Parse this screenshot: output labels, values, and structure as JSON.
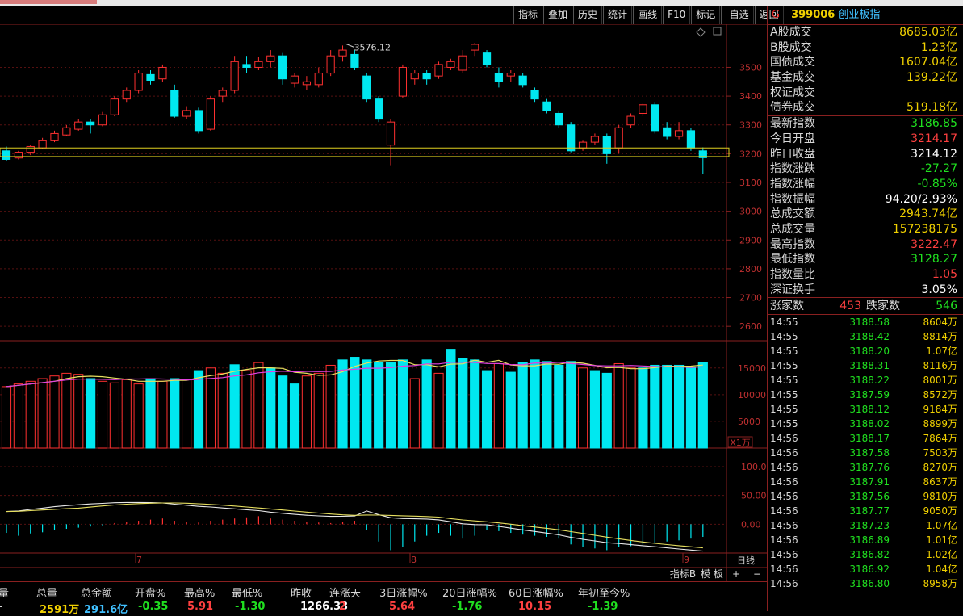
{
  "toolbar": [
    "指标",
    "叠加",
    "历史",
    "统计",
    "画线",
    "F10",
    "标记",
    "-自选",
    "返回"
  ],
  "quote": {
    "flag": "G",
    "code": "399006",
    "name": "创业板指",
    "rows1": [
      {
        "label": "A股成交",
        "value": "8685.03亿",
        "color": "#f0d000"
      },
      {
        "label": "B股成交",
        "value": "1.23亿",
        "color": "#f0d000"
      },
      {
        "label": "国债成交",
        "value": "1607.04亿",
        "color": "#f0d000"
      },
      {
        "label": "基金成交",
        "value": "139.22亿",
        "color": "#f0d000"
      },
      {
        "label": "权证成交",
        "value": "",
        "color": "#f0d000"
      },
      {
        "label": "债券成交",
        "value": "519.18亿",
        "color": "#f0d000"
      }
    ],
    "rows2": [
      {
        "label": "最新指数",
        "value": "3186.85",
        "color": "#20e020"
      },
      {
        "label": "今日开盘",
        "value": "3214.17",
        "color": "#ff4040"
      },
      {
        "label": "昨日收盘",
        "value": "3214.12",
        "color": "#ffffff"
      },
      {
        "label": "指数涨跌",
        "value": "-27.27",
        "color": "#20e020"
      },
      {
        "label": "指数涨幅",
        "value": "-0.85%",
        "color": "#20e020"
      },
      {
        "label": "指数振幅",
        "value": "94.20/2.93%",
        "color": "#ffffff"
      },
      {
        "label": "总成交额",
        "value": "2943.74亿",
        "color": "#f0d000"
      },
      {
        "label": "总成交量",
        "value": "157238175",
        "color": "#f0d000"
      },
      {
        "label": "最高指数",
        "value": "3222.47",
        "color": "#ff4040"
      },
      {
        "label": "最低指数",
        "value": "3128.27",
        "color": "#20e020"
      },
      {
        "label": "指数量比",
        "value": "1.05",
        "color": "#ff4040"
      },
      {
        "label": "深证换手",
        "value": "3.05%",
        "color": "#ffffff"
      }
    ],
    "up_label": "涨家数",
    "up_value": "453",
    "down_label": "跌家数",
    "down_value": "546"
  },
  "ticks": [
    {
      "t": "14:55",
      "p": "3188.58",
      "v": "8604万"
    },
    {
      "t": "14:55",
      "p": "3188.42",
      "v": "8814万"
    },
    {
      "t": "14:55",
      "p": "3188.20",
      "v": "1.07亿"
    },
    {
      "t": "14:55",
      "p": "3188.31",
      "v": "8116万"
    },
    {
      "t": "14:55",
      "p": "3188.22",
      "v": "8001万"
    },
    {
      "t": "14:55",
      "p": "3187.59",
      "v": "8572万"
    },
    {
      "t": "14:55",
      "p": "3188.12",
      "v": "9184万"
    },
    {
      "t": "14:55",
      "p": "3188.02",
      "v": "8899万"
    },
    {
      "t": "14:56",
      "p": "3188.17",
      "v": "7864万"
    },
    {
      "t": "14:56",
      "p": "3187.58",
      "v": "7503万"
    },
    {
      "t": "14:56",
      "p": "3187.76",
      "v": "8270万"
    },
    {
      "t": "14:56",
      "p": "3187.91",
      "v": "8637万"
    },
    {
      "t": "14:56",
      "p": "3187.56",
      "v": "9810万"
    },
    {
      "t": "14:56",
      "p": "3187.77",
      "v": "9050万"
    },
    {
      "t": "14:56",
      "p": "3187.23",
      "v": "1.07亿"
    },
    {
      "t": "14:56",
      "p": "3186.89",
      "v": "1.01亿"
    },
    {
      "t": "14:56",
      "p": "3186.82",
      "v": "1.02亿"
    },
    {
      "t": "14:56",
      "p": "3186.92",
      "v": "1.04亿"
    },
    {
      "t": "14:56",
      "p": "3186.80",
      "v": "8958万"
    }
  ],
  "axis": {
    "price": [
      "3500",
      "3400",
      "3300",
      "3200",
      "3100",
      "3000",
      "2900",
      "2800",
      "2700",
      "2600"
    ],
    "volume": [
      "15000",
      "10000",
      "5000"
    ],
    "vol_unit": "X1万",
    "macd": [
      "100.0",
      "50.00",
      "0.00"
    ],
    "months": [
      "7",
      "8",
      "9"
    ],
    "period": "日线",
    "peak": "3576.12"
  },
  "bottom_tools": [
    "指标B",
    "模 板",
    "+",
    "−"
  ],
  "stats": [
    {
      "h": "量",
      "v": ""
    },
    {
      "h": "总量",
      "v": "2591万",
      "c": "#f0d000"
    },
    {
      "h": "总金额",
      "v": "291.6亿",
      "c": "#40c0ff"
    },
    {
      "h": "开盘%",
      "v": "-0.35",
      "c": "#20e020"
    },
    {
      "h": "最高%",
      "v": "5.91",
      "c": "#ff4040"
    },
    {
      "h": "最低%",
      "v": "-1.30",
      "c": "#20e020"
    },
    {
      "h": "昨收",
      "v": "1266.33",
      "c": "#ffffff"
    },
    {
      "h": "连涨天",
      "v": "2",
      "c": "#ff4040"
    },
    {
      "h": "3日涨幅%",
      "v": "5.64",
      "c": "#ff4040"
    },
    {
      "h": "20日涨幅%",
      "v": "-1.76",
      "c": "#20e020"
    },
    {
      "h": "60日涨幅%",
      "v": "10.15",
      "c": "#ff4040"
    },
    {
      "h": "年初至今%",
      "v": "-1.39",
      "c": "#20e020"
    }
  ],
  "chart_data": {
    "type": "candlestick",
    "ylim": [
      2550,
      3650
    ],
    "candles": [
      [
        3210,
        3180,
        3225,
        3175
      ],
      [
        3185,
        3205,
        3210,
        3180
      ],
      [
        3205,
        3225,
        3230,
        3195
      ],
      [
        3220,
        3245,
        3255,
        3215
      ],
      [
        3245,
        3270,
        3280,
        3240
      ],
      [
        3265,
        3290,
        3300,
        3260
      ],
      [
        3285,
        3310,
        3320,
        3280
      ],
      [
        3310,
        3300,
        3320,
        3270
      ],
      [
        3300,
        3335,
        3345,
        3295
      ],
      [
        3335,
        3390,
        3400,
        3330
      ],
      [
        3390,
        3420,
        3430,
        3380
      ],
      [
        3420,
        3480,
        3490,
        3410
      ],
      [
        3475,
        3455,
        3490,
        3440
      ],
      [
        3460,
        3500,
        3510,
        3450
      ],
      [
        3420,
        3330,
        3440,
        3325
      ],
      [
        3330,
        3350,
        3365,
        3320
      ],
      [
        3350,
        3280,
        3360,
        3270
      ],
      [
        3285,
        3390,
        3400,
        3280
      ],
      [
        3400,
        3420,
        3430,
        3380
      ],
      [
        3420,
        3520,
        3540,
        3410
      ],
      [
        3510,
        3500,
        3540,
        3480
      ],
      [
        3500,
        3520,
        3535,
        3490
      ],
      [
        3520,
        3540,
        3560,
        3500
      ],
      [
        3540,
        3460,
        3550,
        3440
      ],
      [
        3445,
        3470,
        3480,
        3430
      ],
      [
        3440,
        3450,
        3470,
        3420
      ],
      [
        3440,
        3480,
        3500,
        3430
      ],
      [
        3480,
        3540,
        3560,
        3470
      ],
      [
        3540,
        3560,
        3576,
        3520
      ],
      [
        3545,
        3500,
        3560,
        3490
      ],
      [
        3470,
        3390,
        3480,
        3380
      ],
      [
        3390,
        3320,
        3400,
        3310
      ],
      [
        3230,
        3310,
        3320,
        3160
      ],
      [
        3400,
        3500,
        3510,
        3395
      ],
      [
        3460,
        3480,
        3490,
        3440
      ],
      [
        3480,
        3460,
        3490,
        3440
      ],
      [
        3470,
        3510,
        3520,
        3460
      ],
      [
        3500,
        3520,
        3530,
        3490
      ],
      [
        3490,
        3540,
        3560,
        3480
      ],
      [
        3560,
        3580,
        3585,
        3540
      ],
      [
        3550,
        3510,
        3560,
        3500
      ],
      [
        3480,
        3450,
        3500,
        3430
      ],
      [
        3470,
        3480,
        3490,
        3450
      ],
      [
        3470,
        3440,
        3480,
        3430
      ],
      [
        3420,
        3390,
        3430,
        3380
      ],
      [
        3380,
        3350,
        3390,
        3340
      ],
      [
        3340,
        3300,
        3350,
        3290
      ],
      [
        3300,
        3210,
        3310,
        3205
      ],
      [
        3220,
        3240,
        3245,
        3210
      ],
      [
        3240,
        3260,
        3270,
        3230
      ],
      [
        3260,
        3200,
        3270,
        3165
      ],
      [
        3220,
        3290,
        3300,
        3200
      ],
      [
        3300,
        3330,
        3340,
        3290
      ],
      [
        3340,
        3370,
        3375,
        3330
      ],
      [
        3370,
        3280,
        3380,
        3270
      ],
      [
        3290,
        3260,
        3310,
        3250
      ],
      [
        3260,
        3280,
        3310,
        3250
      ],
      [
        3280,
        3220,
        3290,
        3210
      ],
      [
        3210,
        3186,
        3222,
        3128
      ]
    ],
    "volume": [
      [
        11500,
        0
      ],
      [
        12000,
        0
      ],
      [
        12500,
        0
      ],
      [
        13000,
        0
      ],
      [
        13500,
        0
      ],
      [
        14000,
        0
      ],
      [
        13800,
        0
      ],
      [
        13000,
        1
      ],
      [
        12500,
        0
      ],
      [
        12200,
        0
      ],
      [
        12800,
        0
      ],
      [
        12000,
        0
      ],
      [
        13000,
        1
      ],
      [
        12500,
        0
      ],
      [
        13000,
        1
      ],
      [
        12800,
        0
      ],
      [
        14500,
        1
      ],
      [
        15000,
        0
      ],
      [
        14000,
        0
      ],
      [
        15600,
        1
      ],
      [
        14500,
        0
      ],
      [
        16000,
        0
      ],
      [
        15000,
        1
      ],
      [
        13500,
        1
      ],
      [
        12000,
        1
      ],
      [
        13500,
        0
      ],
      [
        14000,
        0
      ],
      [
        15500,
        0
      ],
      [
        16500,
        1
      ],
      [
        17000,
        1
      ],
      [
        16500,
        1
      ],
      [
        16000,
        1
      ],
      [
        16000,
        1
      ],
      [
        16500,
        1
      ],
      [
        13000,
        0
      ],
      [
        16500,
        1
      ],
      [
        14000,
        0
      ],
      [
        18500,
        1
      ],
      [
        16800,
        1
      ],
      [
        16500,
        1
      ],
      [
        14500,
        1
      ],
      [
        15800,
        0
      ],
      [
        14200,
        1
      ],
      [
        16000,
        1
      ],
      [
        16500,
        1
      ],
      [
        16200,
        1
      ],
      [
        15500,
        1
      ],
      [
        16200,
        1
      ],
      [
        15000,
        0
      ],
      [
        14500,
        1
      ],
      [
        14000,
        1
      ],
      [
        15800,
        0
      ],
      [
        15000,
        0
      ],
      [
        15000,
        1
      ],
      [
        15500,
        1
      ],
      [
        15500,
        1
      ],
      [
        15500,
        1
      ],
      [
        15200,
        1
      ],
      [
        16000,
        1
      ]
    ],
    "macd": [
      -15,
      -20,
      -16,
      -14,
      -10,
      -8,
      -6,
      -4,
      -2,
      2,
      4,
      6,
      8,
      10,
      6,
      4,
      3,
      6,
      8,
      10,
      12,
      14,
      10,
      8,
      6,
      4,
      3,
      2,
      4,
      6,
      -10,
      -30,
      -45,
      -40,
      -30,
      -20,
      -15,
      -20,
      -25,
      -20,
      -10,
      -12,
      -15,
      -18,
      -20,
      -22,
      -25,
      -35,
      -40,
      -42,
      -45,
      -40,
      -38,
      -35,
      -32,
      -30,
      -28,
      -25,
      -22
    ]
  }
}
